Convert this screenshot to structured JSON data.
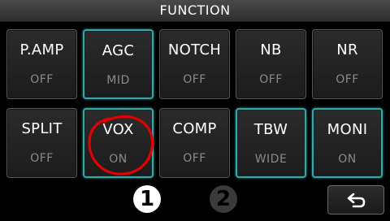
{
  "title": "FUNCTION",
  "colors": {
    "accent": "#3aa7a7",
    "annotation": "#e00000"
  },
  "row1": [
    {
      "name": "P.AMP",
      "value": "OFF",
      "active": false
    },
    {
      "name": "AGC",
      "value": "MID",
      "active": true
    },
    {
      "name": "NOTCH",
      "value": "OFF",
      "active": false
    },
    {
      "name": "NB",
      "value": "OFF",
      "active": false
    },
    {
      "name": "NR",
      "value": "OFF",
      "active": false
    }
  ],
  "row2": [
    {
      "name": "SPLIT",
      "value": "OFF",
      "active": false
    },
    {
      "name": "VOX",
      "value": "ON",
      "active": true
    },
    {
      "name": "COMP",
      "value": "OFF",
      "active": false
    },
    {
      "name": "TBW",
      "value": "WIDE",
      "active": true
    },
    {
      "name": "MONI",
      "value": "ON",
      "active": true
    }
  ],
  "pages": {
    "active": "1",
    "inactive": "2"
  },
  "back_icon": "return-arrow-icon"
}
